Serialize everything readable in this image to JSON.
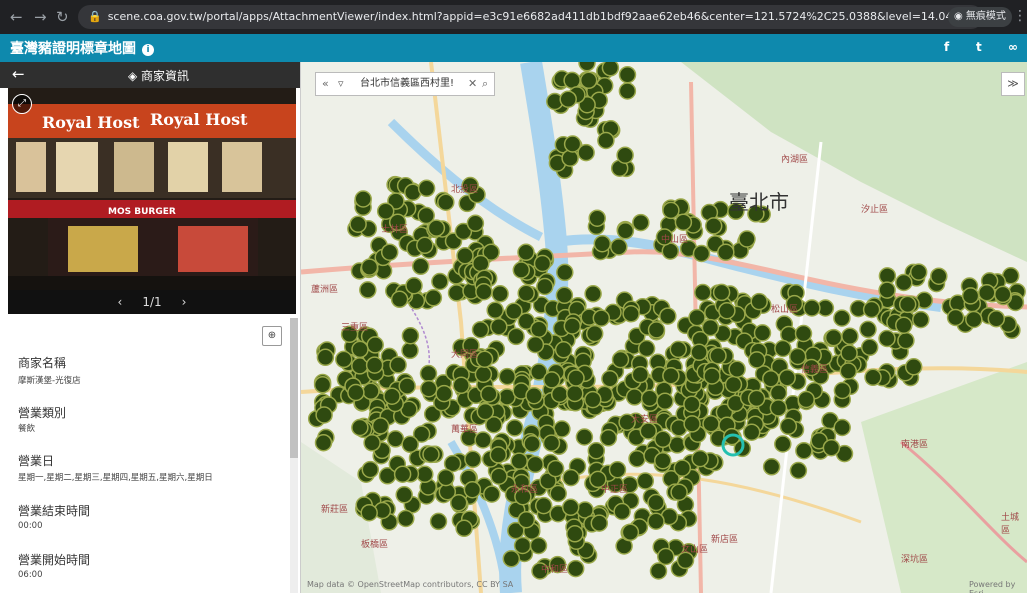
{
  "browser": {
    "url": "scene.coa.gov.tw/portal/apps/AttachmentViewer/index.html?appid=e3c91e6682ad411db1bdf92aae62eb46&center=121.5724%2C25.0388&level=14.0409&attachmentIndex=0&selectedL...",
    "profile_label": "無痕模式"
  },
  "app": {
    "title": "臺灣豬證明標章地圖",
    "share": [
      "f",
      "t",
      "link"
    ]
  },
  "panel": {
    "title": "商家資訊",
    "pager": "1/1",
    "photo_signs": [
      "Royal Host",
      "Royal Host",
      "MOS BURGER"
    ],
    "fields": [
      {
        "label": "商家名稱",
        "value": "摩斯漢堡-光復店"
      },
      {
        "label": "營業類別",
        "value": "餐飲"
      },
      {
        "label": "營業日",
        "value": "星期一,星期二,星期三,星期四,星期五,星期六,星期日"
      },
      {
        "label": "營業結束時間",
        "value": "00:00"
      },
      {
        "label": "營業開始時間",
        "value": "06:00"
      }
    ]
  },
  "map": {
    "search_text": "台北市信義區西村里!",
    "city_label": "臺北市",
    "districts": [
      "北投區",
      "士林區",
      "內湖區",
      "中山區",
      "松山區",
      "大同區",
      "萬華區",
      "大安區",
      "信義區",
      "南港區",
      "中正區",
      "文山區",
      "深坑區",
      "汐止區",
      "蘆洲區",
      "三重區",
      "新莊區",
      "板橋區",
      "永和區",
      "中和區",
      "新店區",
      "土城區"
    ],
    "attribution": "Map data © OpenStreetMap contributors, CC BY SA",
    "powered": "Powered by Esri",
    "marker_color": "#2f4a10",
    "selected_color": "#25c0b0"
  }
}
